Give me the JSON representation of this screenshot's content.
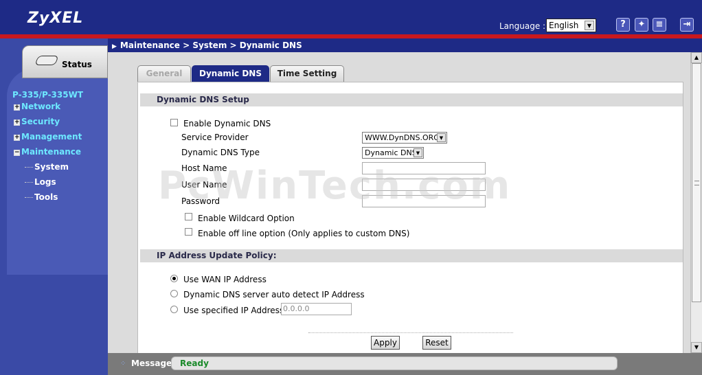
{
  "header": {
    "logo": "ZyXEL",
    "language_label": "Language :",
    "language_value": "English",
    "icons": [
      "help-icon",
      "wizard-icon",
      "notes-icon",
      "logout-icon"
    ]
  },
  "sidebar": {
    "status_label": "Status",
    "model": "P-335/P-335WT",
    "items": [
      {
        "label": "Network",
        "marker": "+"
      },
      {
        "label": "Security",
        "marker": "+"
      },
      {
        "label": "Management",
        "marker": "+"
      },
      {
        "label": "Maintenance",
        "marker": "−"
      }
    ],
    "subitems": [
      "System",
      "Logs",
      "Tools"
    ]
  },
  "breadcrumb": "Maintenance > System > Dynamic DNS",
  "tabs": [
    {
      "label": "General",
      "state": "disabled"
    },
    {
      "label": "Dynamic DNS",
      "state": "active"
    },
    {
      "label": "Time Setting",
      "state": "normal"
    }
  ],
  "ddns": {
    "section_title": "Dynamic DNS Setup",
    "enable_label": "Enable Dynamic DNS",
    "service_provider_label": "Service Provider",
    "service_provider_value": "WWW.DynDNS.ORG",
    "ddns_type_label": "Dynamic DNS Type",
    "ddns_type_value": "Dynamic DNS",
    "host_name_label": "Host Name",
    "user_name_label": "User Name",
    "password_label": "Password",
    "wildcard_label": "Enable Wildcard Option",
    "offline_label": "Enable off line option (Only applies to custom DNS)"
  },
  "ip_policy": {
    "section_title": "IP Address Update Policy:",
    "option_wan": "Use WAN IP Address",
    "option_auto": "Dynamic DNS server auto detect IP Address",
    "option_specified": "Use specified IP Address",
    "specified_ip_placeholder": "0.0.0.0",
    "selected": "wan"
  },
  "buttons": {
    "apply": "Apply",
    "reset": "Reset"
  },
  "watermark": "PcWinTech.com",
  "message": {
    "label": "Message",
    "value": "Ready",
    "value_color": "#1a8a2a"
  },
  "colors": {
    "header_bg": "#1e2a86",
    "accent_red": "#c8181e",
    "nav_text": "#6de8ff"
  }
}
